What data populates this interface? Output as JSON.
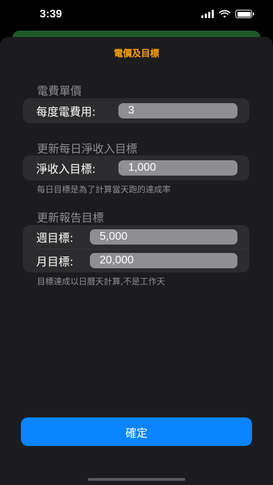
{
  "status_bar": {
    "time": "3:39",
    "icons": [
      "signal-bars",
      "wifi",
      "battery-full"
    ]
  },
  "sheet": {
    "title": "電價及目標",
    "accent_color": "#ff9f0a"
  },
  "electricity_section": {
    "header": "電費單價",
    "rows": [
      {
        "label": "每度電費用:",
        "value": "3"
      }
    ]
  },
  "daily_section": {
    "header": "更新每日淨收入目標",
    "rows": [
      {
        "label": "淨收入目標:",
        "value": "1,000"
      }
    ],
    "footnote": "每日目標是為了計算當天跑的達成率"
  },
  "report_section": {
    "header": "更新報告目標",
    "rows": [
      {
        "label": "週目標:",
        "value": "5,000"
      },
      {
        "label": "月目標:",
        "value": "20,000"
      }
    ],
    "footnote": "目標達成以日曆天計算,不是工作天"
  },
  "confirm_button": {
    "label": "確定",
    "color": "#0a84ff"
  }
}
